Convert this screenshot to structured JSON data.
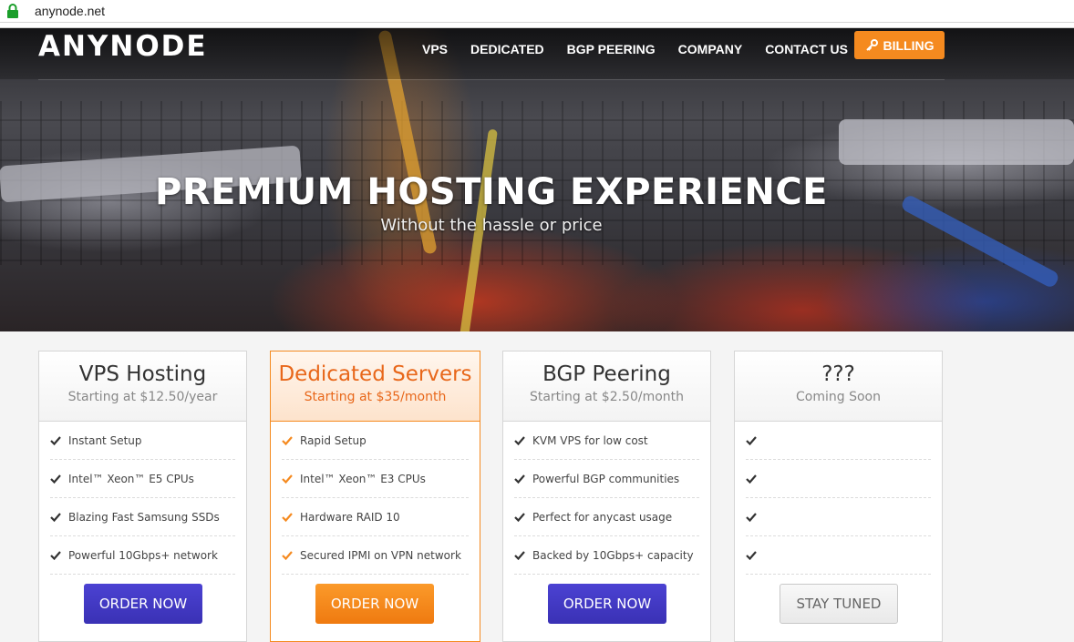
{
  "browser": {
    "url": "anynode.net",
    "lock_icon": "lock-icon"
  },
  "nav": {
    "logo": "ANYNODE",
    "items": [
      "VPS",
      "DEDICATED",
      "BGP PEERING",
      "COMPANY",
      "CONTACT US"
    ],
    "billing_label": "BILLING",
    "billing_icon": "key-icon",
    "billing_color": "#f58a1f"
  },
  "hero": {
    "title": "PREMIUM HOSTING EXPERIENCE",
    "subtitle": "Without the hassle or price"
  },
  "plans": [
    {
      "title": "VPS Hosting",
      "subtitle": "Starting at $12.50/year",
      "features": [
        "Instant Setup",
        "Intel™ Xeon™ E5 CPUs",
        "Blazing Fast Samsung SSDs",
        "Powerful 10Gbps+ network"
      ],
      "button": "ORDER NOW",
      "check_color": "#333333"
    },
    {
      "title": "Dedicated Servers",
      "subtitle": "Starting at $35/month",
      "features": [
        "Rapid Setup",
        "Intel™ Xeon™ E3 CPUs",
        "Hardware RAID 10",
        "Secured IPMI on VPN network"
      ],
      "button": "ORDER NOW",
      "check_color": "#f58a1f"
    },
    {
      "title": "BGP Peering",
      "subtitle": "Starting at $2.50/month",
      "features": [
        "KVM VPS for low cost",
        "Powerful BGP communities",
        "Perfect for anycast usage",
        "Backed by 10Gbps+ capacity"
      ],
      "button": "ORDER NOW",
      "check_color": "#333333"
    },
    {
      "title": "???",
      "subtitle": "Coming Soon",
      "features": [
        "",
        "",
        "",
        ""
      ],
      "button": "STAY TUNED",
      "check_color": "#333333"
    }
  ],
  "colors": {
    "accent_orange": "#f58a1f",
    "button_purple": "#4b42d2"
  }
}
